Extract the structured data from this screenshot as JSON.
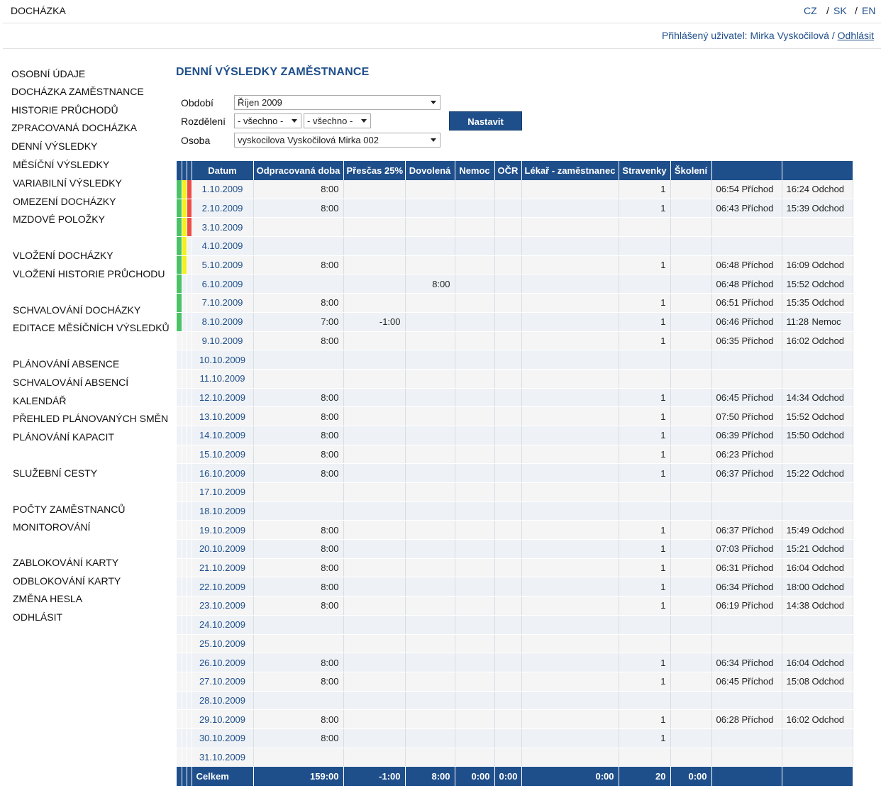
{
  "app": {
    "title": "DOCHÁZKA"
  },
  "languages": [
    "CZ",
    "SK",
    "EN"
  ],
  "user": {
    "prefix": "Přihlášený uživatel: Mirka Vyskočilová /",
    "logout": "Odhlásit"
  },
  "sidebar": {
    "items": [
      "OSOBNÍ ÚDAJE",
      "DOCHÁZKA ZAMĚSTNANCE",
      "HISTORIE PRŮCHODŮ",
      "ZPRACOVANÁ DOCHÁZKA",
      "DENNÍ VÝSLEDKY",
      "MĚSÍČNÍ VÝSLEDKY",
      "VARIABILNÍ VÝSLEDKY",
      "OMEZENÍ DOCHÁZKY",
      "MZDOVÉ POLOŽKY",
      "VLOŽENÍ DOCHÁZKY",
      "VLOŽENÍ HISTORIE PRŮCHODU",
      "SCHVALOVÁNÍ DOCHÁZKY",
      "EDITACE MĚSÍČNÍCH VÝSLEDKŮ",
      "PLÁNOVÁNÍ ABSENCE",
      "SCHVALOVÁNÍ ABSENCÍ",
      "KALENDÁŘ",
      "PŘEHLED PLÁNOVANÝCH SMĚN",
      "PLÁNOVÁNÍ KAPACIT",
      "SLUŽEBNÍ CESTY",
      "POČTY ZAMĚSTNANCŮ",
      "MONITOROVÁNÍ",
      "ZABLOKOVÁNÍ KARTY",
      "ODBLOKOVÁNÍ KARTY",
      "ZMĚNA HESLA",
      "ODHLÁSIT"
    ]
  },
  "page": {
    "title": "DENNÍ VÝSLEDKY ZAMĚSTNANCE"
  },
  "filters": {
    "period_label": "Období",
    "period_value": "Říjen 2009",
    "division_label": "Rozdělení",
    "division_value1": "- všechno -",
    "division_value2": "- všechno -",
    "person_label": "Osoba",
    "person_value": "vyskocilova Vyskočilová Mirka 002",
    "submit_label": "Nastavit"
  },
  "table": {
    "columns": [
      "Datum",
      "Odpracovaná doba",
      "Přesčas 25%",
      "Dovolená",
      "Nemoc",
      "OČR",
      "Lékař - zaměstnanec",
      "Stravenky",
      "Školení"
    ],
    "colors": {
      "green": "#4cc266",
      "yellow": "#f4f020",
      "red": "#ee4b4b",
      "header": "#1f4f8b"
    },
    "rows": [
      {
        "date": "1.10.2009",
        "worked": "8:00",
        "over": "",
        "vac": "",
        "sick": "",
        "ocr": "",
        "doc": "",
        "meal": "1",
        "train": "",
        "in_t": "06:54",
        "in_l": "Příchod",
        "out_t": "16:24",
        "out_l": "Odchod",
        "ind": [
          "green",
          "yellow",
          "red"
        ]
      },
      {
        "date": "2.10.2009",
        "worked": "8:00",
        "over": "",
        "vac": "",
        "sick": "",
        "ocr": "",
        "doc": "",
        "meal": "1",
        "train": "",
        "in_t": "06:43",
        "in_l": "Příchod",
        "out_t": "15:39",
        "out_l": "Odchod",
        "ind": [
          "green",
          "yellow",
          "red"
        ]
      },
      {
        "date": "3.10.2009",
        "worked": "",
        "over": "",
        "vac": "",
        "sick": "",
        "ocr": "",
        "doc": "",
        "meal": "",
        "train": "",
        "in_t": "",
        "in_l": "",
        "out_t": "",
        "out_l": "",
        "ind": [
          "green",
          "yellow",
          "red"
        ]
      },
      {
        "date": "4.10.2009",
        "worked": "",
        "over": "",
        "vac": "",
        "sick": "",
        "ocr": "",
        "doc": "",
        "meal": "",
        "train": "",
        "in_t": "",
        "in_l": "",
        "out_t": "",
        "out_l": "",
        "ind": [
          "green",
          "yellow",
          ""
        ]
      },
      {
        "date": "5.10.2009",
        "worked": "8:00",
        "over": "",
        "vac": "",
        "sick": "",
        "ocr": "",
        "doc": "",
        "meal": "1",
        "train": "",
        "in_t": "06:48",
        "in_l": "Příchod",
        "out_t": "16:09",
        "out_l": "Odchod",
        "ind": [
          "green",
          "yellow",
          ""
        ]
      },
      {
        "date": "6.10.2009",
        "worked": "",
        "over": "",
        "vac": "8:00",
        "sick": "",
        "ocr": "",
        "doc": "",
        "meal": "",
        "train": "",
        "in_t": "06:48",
        "in_l": "Příchod",
        "out_t": "15:52",
        "out_l": "Odchod",
        "ind": [
          "green",
          "",
          ""
        ]
      },
      {
        "date": "7.10.2009",
        "worked": "8:00",
        "over": "",
        "vac": "",
        "sick": "",
        "ocr": "",
        "doc": "",
        "meal": "1",
        "train": "",
        "in_t": "06:51",
        "in_l": "Příchod",
        "out_t": "15:35",
        "out_l": "Odchod",
        "ind": [
          "green",
          "",
          ""
        ]
      },
      {
        "date": "8.10.2009",
        "worked": "7:00",
        "over": "-1:00",
        "vac": "",
        "sick": "",
        "ocr": "",
        "doc": "",
        "meal": "1",
        "train": "",
        "in_t": "06:46",
        "in_l": "Příchod",
        "out_t": "11:28",
        "out_l": "Nemoc",
        "ind": [
          "green",
          "",
          ""
        ]
      },
      {
        "date": "9.10.2009",
        "worked": "8:00",
        "over": "",
        "vac": "",
        "sick": "",
        "ocr": "",
        "doc": "",
        "meal": "1",
        "train": "",
        "in_t": "06:35",
        "in_l": "Příchod",
        "out_t": "16:02",
        "out_l": "Odchod",
        "ind": [
          "",
          "",
          ""
        ]
      },
      {
        "date": "10.10.2009",
        "worked": "",
        "over": "",
        "vac": "",
        "sick": "",
        "ocr": "",
        "doc": "",
        "meal": "",
        "train": "",
        "in_t": "",
        "in_l": "",
        "out_t": "",
        "out_l": "",
        "ind": [
          "",
          "",
          ""
        ]
      },
      {
        "date": "11.10.2009",
        "worked": "",
        "over": "",
        "vac": "",
        "sick": "",
        "ocr": "",
        "doc": "",
        "meal": "",
        "train": "",
        "in_t": "",
        "in_l": "",
        "out_t": "",
        "out_l": "",
        "ind": [
          "",
          "",
          ""
        ]
      },
      {
        "date": "12.10.2009",
        "worked": "8:00",
        "over": "",
        "vac": "",
        "sick": "",
        "ocr": "",
        "doc": "",
        "meal": "1",
        "train": "",
        "in_t": "06:45",
        "in_l": "Příchod",
        "out_t": "14:34",
        "out_l": "Odchod",
        "ind": [
          "",
          "",
          ""
        ]
      },
      {
        "date": "13.10.2009",
        "worked": "8:00",
        "over": "",
        "vac": "",
        "sick": "",
        "ocr": "",
        "doc": "",
        "meal": "1",
        "train": "",
        "in_t": "07:50",
        "in_l": "Příchod",
        "out_t": "15:52",
        "out_l": "Odchod",
        "ind": [
          "",
          "",
          ""
        ]
      },
      {
        "date": "14.10.2009",
        "worked": "8:00",
        "over": "",
        "vac": "",
        "sick": "",
        "ocr": "",
        "doc": "",
        "meal": "1",
        "train": "",
        "in_t": "06:39",
        "in_l": "Příchod",
        "out_t": "15:50",
        "out_l": "Odchod",
        "ind": [
          "",
          "",
          ""
        ]
      },
      {
        "date": "15.10.2009",
        "worked": "8:00",
        "over": "",
        "vac": "",
        "sick": "",
        "ocr": "",
        "doc": "",
        "meal": "1",
        "train": "",
        "in_t": "06:23",
        "in_l": "Příchod",
        "out_t": "",
        "out_l": "",
        "ind": [
          "",
          "",
          ""
        ]
      },
      {
        "date": "16.10.2009",
        "worked": "8:00",
        "over": "",
        "vac": "",
        "sick": "",
        "ocr": "",
        "doc": "",
        "meal": "1",
        "train": "",
        "in_t": "06:37",
        "in_l": "Příchod",
        "out_t": "15:22",
        "out_l": "Odchod",
        "ind": [
          "",
          "",
          ""
        ]
      },
      {
        "date": "17.10.2009",
        "worked": "",
        "over": "",
        "vac": "",
        "sick": "",
        "ocr": "",
        "doc": "",
        "meal": "",
        "train": "",
        "in_t": "",
        "in_l": "",
        "out_t": "",
        "out_l": "",
        "ind": [
          "",
          "",
          ""
        ]
      },
      {
        "date": "18.10.2009",
        "worked": "",
        "over": "",
        "vac": "",
        "sick": "",
        "ocr": "",
        "doc": "",
        "meal": "",
        "train": "",
        "in_t": "",
        "in_l": "",
        "out_t": "",
        "out_l": "",
        "ind": [
          "",
          "",
          ""
        ]
      },
      {
        "date": "19.10.2009",
        "worked": "8:00",
        "over": "",
        "vac": "",
        "sick": "",
        "ocr": "",
        "doc": "",
        "meal": "1",
        "train": "",
        "in_t": "06:37",
        "in_l": "Příchod",
        "out_t": "15:49",
        "out_l": "Odchod",
        "ind": [
          "",
          "",
          ""
        ]
      },
      {
        "date": "20.10.2009",
        "worked": "8:00",
        "over": "",
        "vac": "",
        "sick": "",
        "ocr": "",
        "doc": "",
        "meal": "1",
        "train": "",
        "in_t": "07:03",
        "in_l": "Příchod",
        "out_t": "15:21",
        "out_l": "Odchod",
        "ind": [
          "",
          "",
          ""
        ]
      },
      {
        "date": "21.10.2009",
        "worked": "8:00",
        "over": "",
        "vac": "",
        "sick": "",
        "ocr": "",
        "doc": "",
        "meal": "1",
        "train": "",
        "in_t": "06:31",
        "in_l": "Příchod",
        "out_t": "16:04",
        "out_l": "Odchod",
        "ind": [
          "",
          "",
          ""
        ]
      },
      {
        "date": "22.10.2009",
        "worked": "8:00",
        "over": "",
        "vac": "",
        "sick": "",
        "ocr": "",
        "doc": "",
        "meal": "1",
        "train": "",
        "in_t": "06:34",
        "in_l": "Příchod",
        "out_t": "18:00",
        "out_l": "Odchod",
        "ind": [
          "",
          "",
          ""
        ]
      },
      {
        "date": "23.10.2009",
        "worked": "8:00",
        "over": "",
        "vac": "",
        "sick": "",
        "ocr": "",
        "doc": "",
        "meal": "1",
        "train": "",
        "in_t": "06:19",
        "in_l": "Příchod",
        "out_t": "14:38",
        "out_l": "Odchod",
        "ind": [
          "",
          "",
          ""
        ]
      },
      {
        "date": "24.10.2009",
        "worked": "",
        "over": "",
        "vac": "",
        "sick": "",
        "ocr": "",
        "doc": "",
        "meal": "",
        "train": "",
        "in_t": "",
        "in_l": "",
        "out_t": "",
        "out_l": "",
        "ind": [
          "",
          "",
          ""
        ]
      },
      {
        "date": "25.10.2009",
        "worked": "",
        "over": "",
        "vac": "",
        "sick": "",
        "ocr": "",
        "doc": "",
        "meal": "",
        "train": "",
        "in_t": "",
        "in_l": "",
        "out_t": "",
        "out_l": "",
        "ind": [
          "",
          "",
          ""
        ]
      },
      {
        "date": "26.10.2009",
        "worked": "8:00",
        "over": "",
        "vac": "",
        "sick": "",
        "ocr": "",
        "doc": "",
        "meal": "1",
        "train": "",
        "in_t": "06:34",
        "in_l": "Příchod",
        "out_t": "16:04",
        "out_l": "Odchod",
        "ind": [
          "",
          "",
          ""
        ]
      },
      {
        "date": "27.10.2009",
        "worked": "8:00",
        "over": "",
        "vac": "",
        "sick": "",
        "ocr": "",
        "doc": "",
        "meal": "1",
        "train": "",
        "in_t": "06:45",
        "in_l": "Příchod",
        "out_t": "15:08",
        "out_l": "Odchod",
        "ind": [
          "",
          "",
          ""
        ]
      },
      {
        "date": "28.10.2009",
        "worked": "",
        "over": "",
        "vac": "",
        "sick": "",
        "ocr": "",
        "doc": "",
        "meal": "",
        "train": "",
        "in_t": "",
        "in_l": "",
        "out_t": "",
        "out_l": "",
        "ind": [
          "",
          "",
          ""
        ]
      },
      {
        "date": "29.10.2009",
        "worked": "8:00",
        "over": "",
        "vac": "",
        "sick": "",
        "ocr": "",
        "doc": "",
        "meal": "1",
        "train": "",
        "in_t": "06:28",
        "in_l": "Příchod",
        "out_t": "16:02",
        "out_l": "Odchod",
        "ind": [
          "",
          "",
          ""
        ]
      },
      {
        "date": "30.10.2009",
        "worked": "8:00",
        "over": "",
        "vac": "",
        "sick": "",
        "ocr": "",
        "doc": "",
        "meal": "1",
        "train": "",
        "in_t": "",
        "in_l": "",
        "out_t": "",
        "out_l": "",
        "ind": [
          "",
          "",
          ""
        ]
      },
      {
        "date": "31.10.2009",
        "worked": "",
        "over": "",
        "vac": "",
        "sick": "",
        "ocr": "",
        "doc": "",
        "meal": "",
        "train": "",
        "in_t": "",
        "in_l": "",
        "out_t": "",
        "out_l": "",
        "ind": [
          "",
          "",
          ""
        ]
      }
    ],
    "totals": {
      "label": "Celkem",
      "worked": "159:00",
      "over": "-1:00",
      "vac": "8:00",
      "sick": "0:00",
      "ocr": "0:00",
      "doc": "0:00",
      "meal": "20",
      "train": "0:00"
    }
  }
}
